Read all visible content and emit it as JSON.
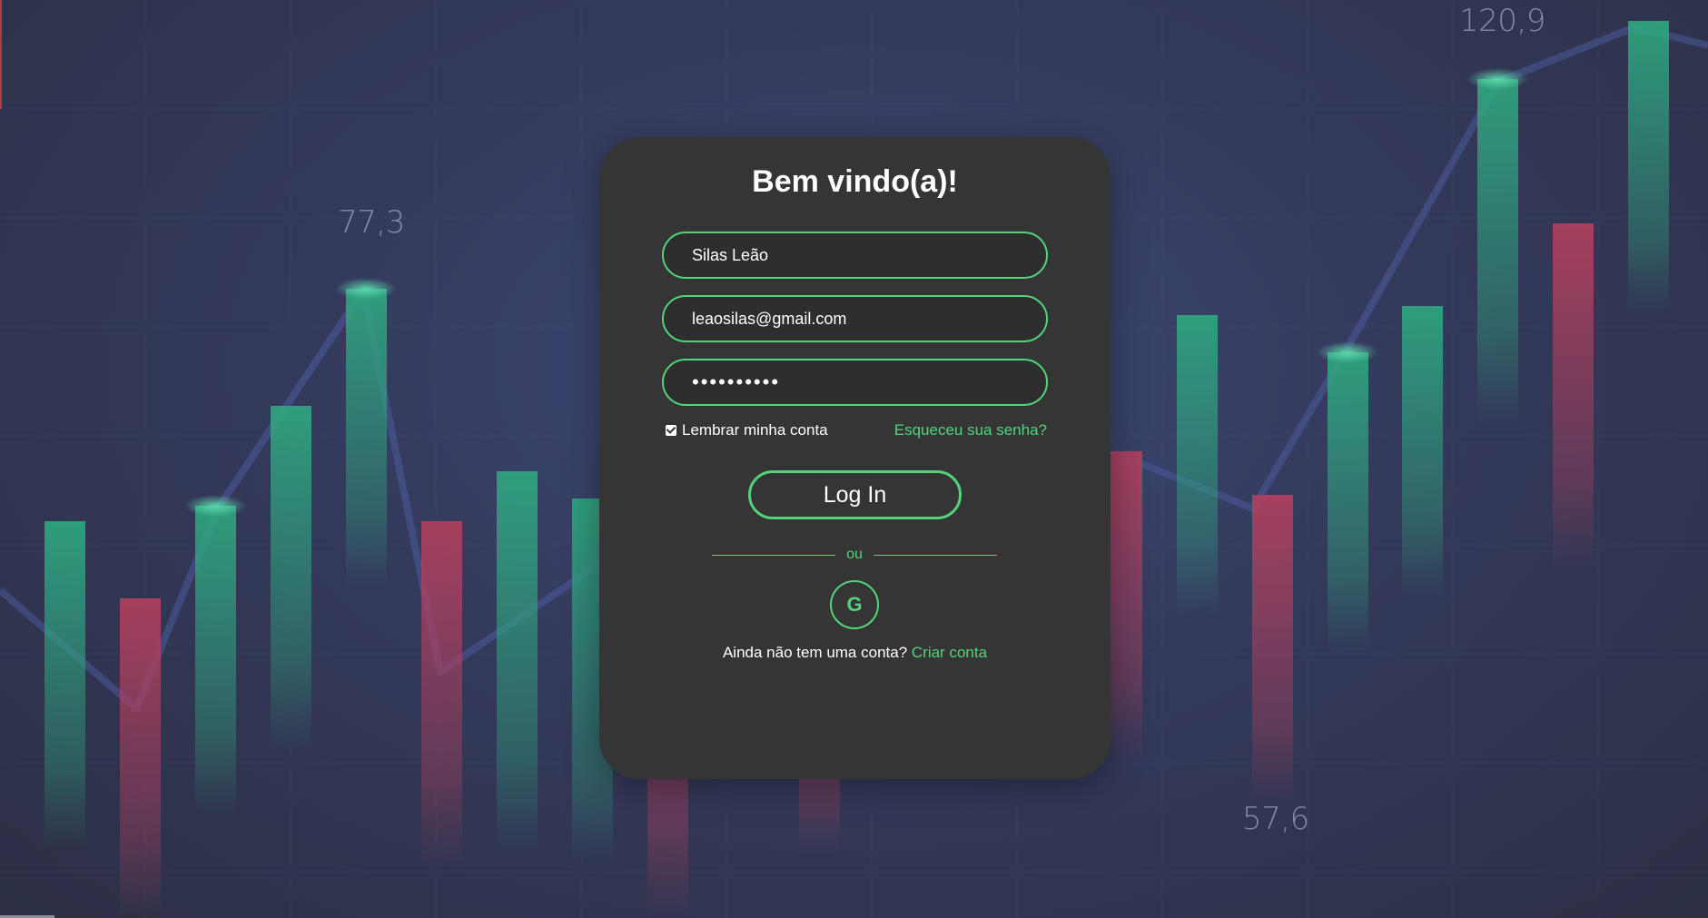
{
  "background": {
    "value_labels": [
      "77,3",
      "120,9",
      "57,6"
    ],
    "colors": {
      "bar_up": "#2fa880",
      "bar_down": "#b2405e",
      "line": "#4a5a9a"
    }
  },
  "login": {
    "title": "Bem vindo(a)!",
    "name_value": "Silas Leão",
    "email_value": "leaosilas@gmail.com",
    "password_mask": "••••••••••",
    "remember_label": "Lembrar minha conta",
    "remember_checked": true,
    "forgot_label": "Esqueceu sua senha?",
    "login_button": "Log In",
    "divider_text": "ou",
    "google_icon": "google-icon",
    "signup_prompt": "Ainda não tem uma conta?",
    "signup_link": "Criar conta"
  },
  "colors": {
    "accent": "#52d47a",
    "card": "#353535",
    "text": "#ffffff"
  }
}
